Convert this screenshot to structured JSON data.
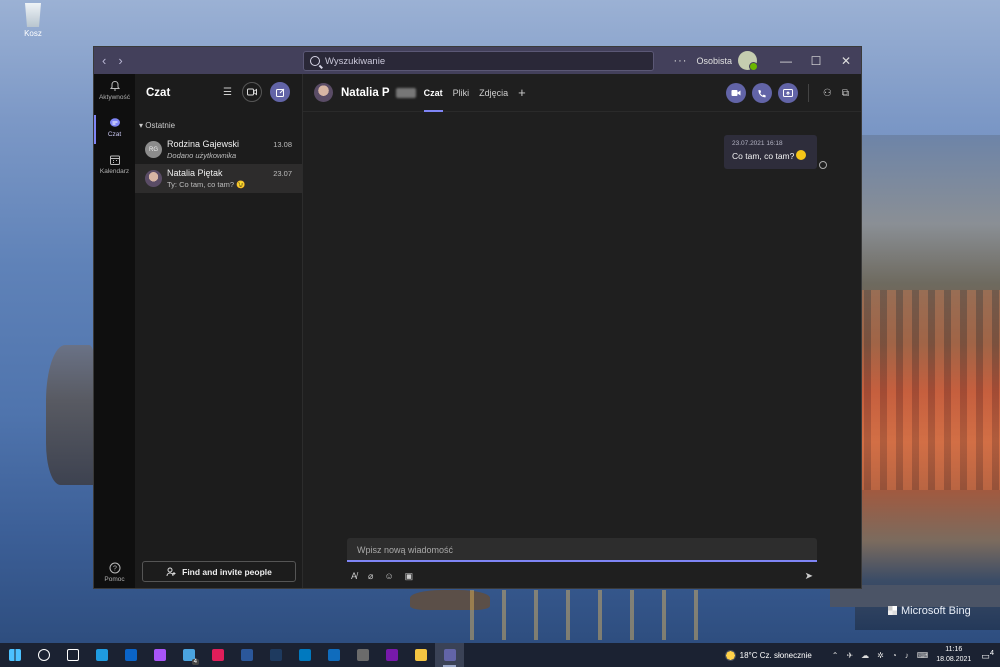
{
  "desktop": {
    "recycle_bin_label": "Kosz",
    "bing_label": "Microsoft Bing"
  },
  "titlebar": {
    "search_placeholder": "Wyszukiwanie",
    "more": "···",
    "org_label": "Osobista",
    "back": "‹",
    "forward": "›",
    "minimize": "—",
    "maximize": "☐",
    "close": "✕"
  },
  "rail": {
    "items": [
      {
        "label": "Aktywność",
        "icon": "bell-icon"
      },
      {
        "label": "Czat",
        "icon": "chat-icon"
      },
      {
        "label": "Kalendarz",
        "icon": "calendar-icon"
      }
    ],
    "help_label": "Pomoc"
  },
  "panel": {
    "title": "Czat",
    "section": "Ostatnie",
    "chats": [
      {
        "name": "Rodzina Gajewski",
        "preview": "Dodano użytkownika",
        "date": "13.08",
        "initials": "RG"
      },
      {
        "name": "Natalia Piętak",
        "preview": "Ty: Co tam, co tam? 😉",
        "date": "23.07"
      }
    ],
    "find_button": "Find and invite people"
  },
  "main": {
    "contact_name": "Natalia P",
    "tabs": [
      "Czat",
      "Pliki",
      "Zdjęcia"
    ],
    "add_tab": "+",
    "message": {
      "timestamp": "23.07.2021 16:18",
      "text": "Co tam, co tam?"
    },
    "compose_placeholder": "Wpisz nową wiadomość"
  },
  "taskbar": {
    "apps": [
      {
        "icon": "windows-icon",
        "color": "#4cc2ff"
      },
      {
        "icon": "search-icon",
        "color": "#ffffff"
      },
      {
        "icon": "task-view-icon",
        "color": "#ffffff"
      },
      {
        "icon": "edge-icon",
        "color": "#1f9be0"
      },
      {
        "icon": "mail-icon",
        "color": "#0a64c8"
      },
      {
        "icon": "messenger-icon",
        "color": "#a855f7"
      },
      {
        "icon": "notes-icon",
        "color": "#4aa3df",
        "badge": "4"
      },
      {
        "icon": "slack-icon",
        "color": "#e01e5a"
      },
      {
        "icon": "word-icon",
        "color": "#2b579a"
      },
      {
        "icon": "photoshop-icon",
        "color": "#1e3a5f"
      },
      {
        "icon": "trello-icon",
        "color": "#0079bf"
      },
      {
        "icon": "outlook-icon",
        "color": "#0f6cbd"
      },
      {
        "icon": "calculator-icon",
        "color": "#6b6b6b"
      },
      {
        "icon": "onenote-icon",
        "color": "#7719aa"
      },
      {
        "icon": "explorer-icon",
        "color": "#f4c542"
      },
      {
        "icon": "teams-icon",
        "color": "#6264a7"
      }
    ],
    "weather": "18°C  Cz. słonecznie",
    "time": "11:16",
    "date": "18.08.2021",
    "notifications": "4"
  }
}
